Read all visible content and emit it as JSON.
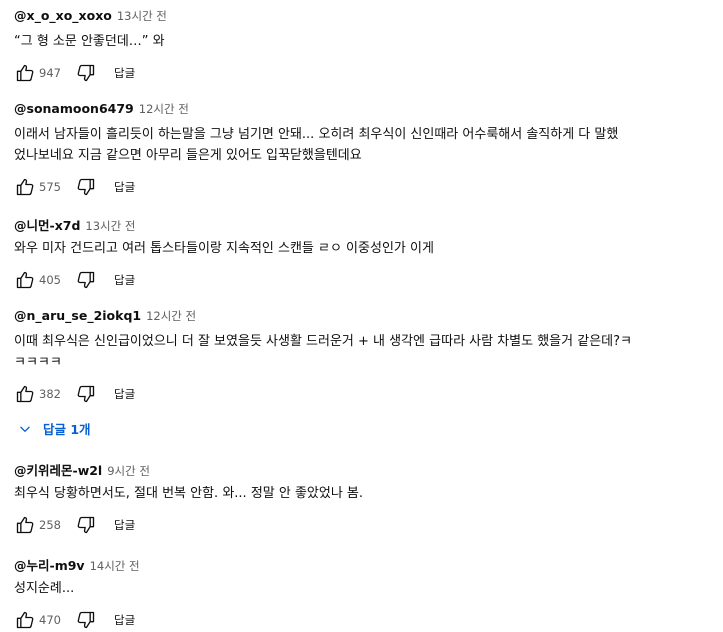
{
  "comments": [
    {
      "handle": "@x_o_xo_xoxo",
      "time": "13시간 전",
      "text": "“그 형 소문 안좋던데…” 와",
      "likes": "947",
      "reply": "답글"
    },
    {
      "handle": "@sonamoon6479",
      "time": "12시간 전",
      "text": "이래서 남자들이 흘리듯이 하는말을 그냥 넘기면 안돼... 오히려 최우식이 신인때라 어수룩해서 솔직하게 다 말했\n었나보네요 지금 같으면 아무리 들은게 있어도 입꾹닫했을텐데요",
      "likes": "575",
      "reply": "답글"
    },
    {
      "handle": "@니먼-x7d",
      "time": "13시간 전",
      "text": "와우 미자 건드리고 여러 톱스타들이랑 지속적인 스캔들 ㄹㅇ 이중성인가 이게",
      "likes": "405",
      "reply": "답글"
    },
    {
      "handle": "@n_aru_se_2iokq1",
      "time": "12시간 전",
      "text": "이때 최우식은 신인급이었으니 더 잘 보였을듯 사생활 드러운거 + 내 생각엔 급따라 사람 차별도 했을거 같은데?ㅋ\nㅋㅋㅋㅋ",
      "likes": "382",
      "reply": "답글",
      "replies_label": "답글 1개"
    },
    {
      "handle": "@키위레몬-w2l",
      "time": "9시간 전",
      "text": "최우식 당황하면서도, 절대 번복 안함. 와... 정말 안 좋았었나 봄.",
      "likes": "258",
      "reply": "답글"
    },
    {
      "handle": "@누리-m9v",
      "time": "14시간 전",
      "text": "성지순례...",
      "likes": "470",
      "reply": "답글"
    }
  ],
  "icons": {
    "like": "thumbs-up-icon",
    "dislike": "thumbs-down-icon",
    "expand": "chevron-down-icon"
  },
  "colors": {
    "link": "#065fd4",
    "meta": "#606060",
    "text": "#0f0f0f"
  }
}
